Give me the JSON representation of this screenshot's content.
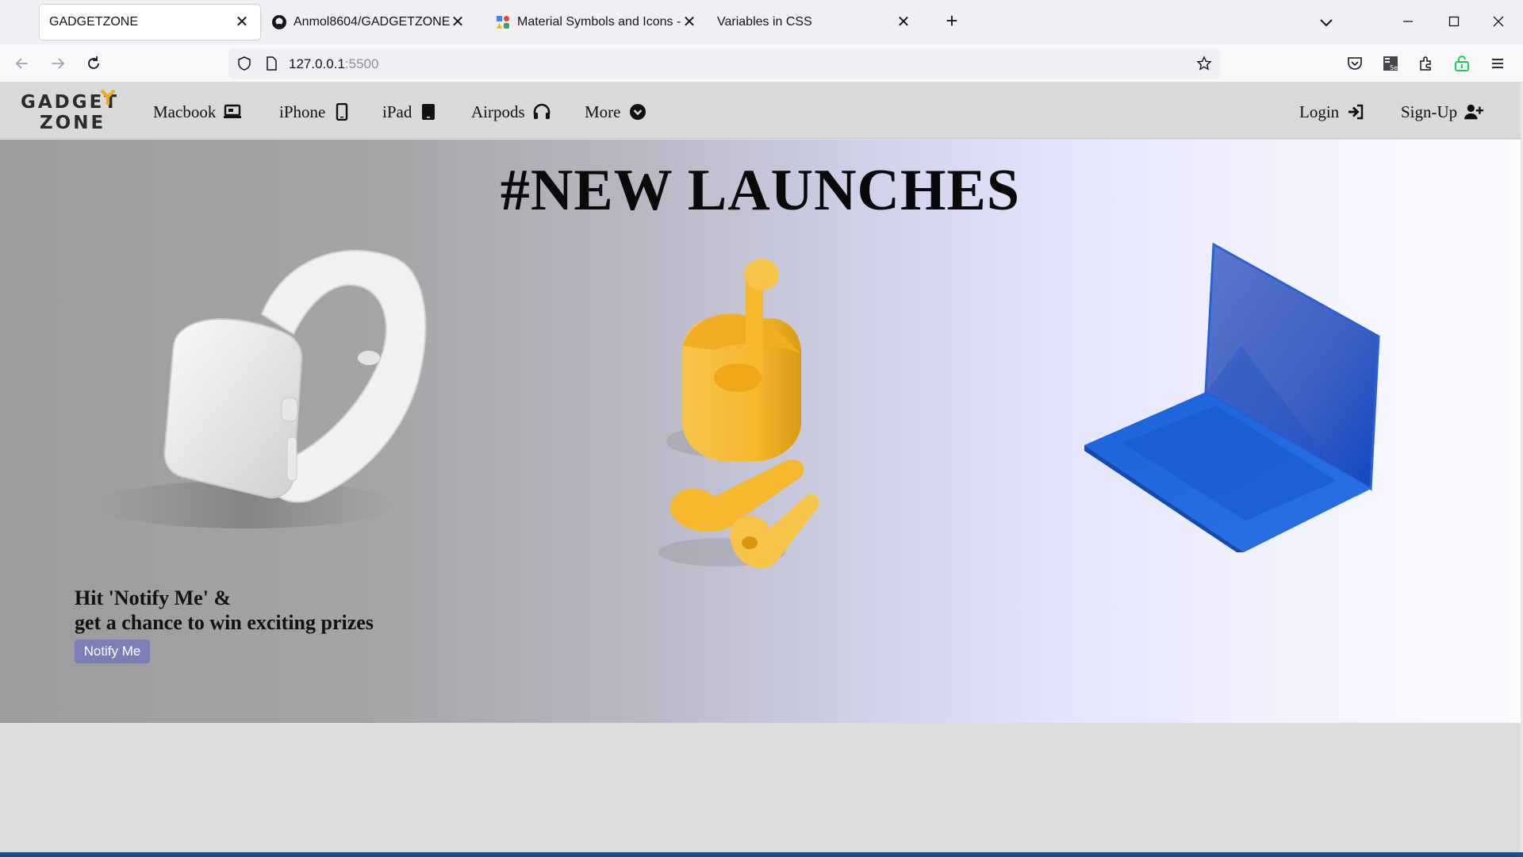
{
  "browser": {
    "tabs": [
      {
        "title": "GADGETZONE",
        "icon": "page-icon",
        "active": true
      },
      {
        "title": "Anmol8604/GADGETZONE",
        "icon": "github-icon",
        "active": false
      },
      {
        "title": "Material Symbols and Icons - G",
        "icon": "google-fonts-icon",
        "active": false
      },
      {
        "title": "Variables in CSS",
        "icon": "page-icon",
        "active": false
      }
    ],
    "url_host": "127.0.0.1",
    "url_port": ":5500"
  },
  "site": {
    "logo_line1": "GADGET",
    "logo_line2": "ZONE",
    "menu": [
      {
        "label": "Macbook",
        "icon": "laptop-icon"
      },
      {
        "label": "iPhone",
        "icon": "smartphone-icon"
      },
      {
        "label": "iPad",
        "icon": "tablet-icon"
      },
      {
        "label": "Airpods",
        "icon": "headphones-icon"
      },
      {
        "label": "More",
        "icon": "expand-circle-icon"
      }
    ],
    "auth": [
      {
        "label": "Login",
        "icon": "login-icon"
      },
      {
        "label": "Sign-Up",
        "icon": "person-add-icon"
      }
    ]
  },
  "hero": {
    "title": "#NEW LAUNCHES",
    "promo_line1": "Hit 'Notify Me' &",
    "promo_line2": "get a chance to win exciting prizes",
    "notify_label": "Notify Me",
    "products": [
      "smartwatch-image",
      "airpods-image",
      "laptop-image"
    ]
  },
  "colors": {
    "notify_button": "#7b7fb5",
    "airpods": "#f5b82e",
    "laptop": "#1f5fd8",
    "watch": "#ececec"
  }
}
